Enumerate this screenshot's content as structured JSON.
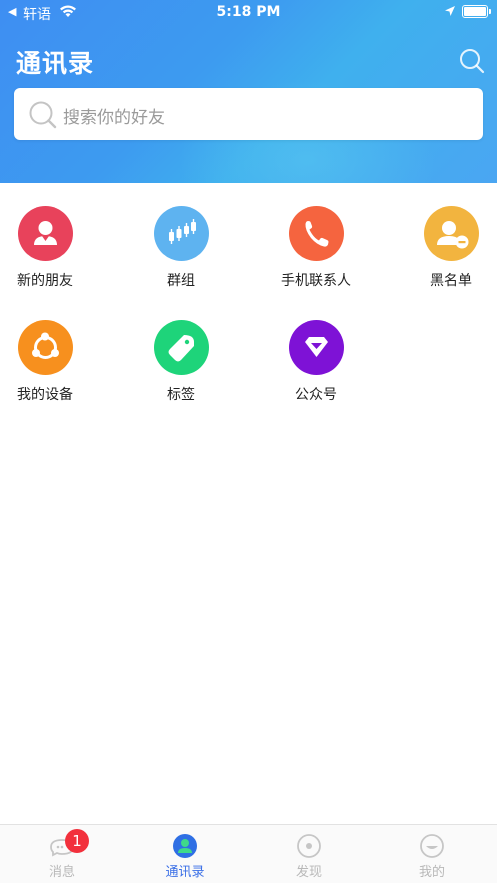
{
  "status_bar": {
    "back_glyph": "◀",
    "carrier": "轩语",
    "time": "5:18 PM"
  },
  "header": {
    "title": "通讯录",
    "search_icon": "search-icon"
  },
  "search": {
    "placeholder": "搜索你的好友"
  },
  "entries": [
    {
      "label": "新的朋友",
      "icon": "new-friend-icon",
      "color": "#e8425b"
    },
    {
      "label": "群组",
      "icon": "group-icon",
      "color": "#5eb3f0"
    },
    {
      "label": "手机联系人",
      "icon": "phone-icon",
      "color": "#f5643f"
    },
    {
      "label": "黑名单",
      "icon": "blacklist-icon",
      "color": "#f2b43f"
    },
    {
      "label": "我的设备",
      "icon": "device-icon",
      "color": "#f7901e"
    },
    {
      "label": "标签",
      "icon": "tag-icon",
      "color": "#1ed47a"
    },
    {
      "label": "公众号",
      "icon": "official-account-icon",
      "color": "#7e12d6"
    }
  ],
  "tabbar": {
    "tabs": [
      {
        "label": "消息",
        "icon": "message-icon",
        "badge": "1",
        "active": false
      },
      {
        "label": "通讯录",
        "icon": "contacts-icon",
        "active": true
      },
      {
        "label": "发现",
        "icon": "discover-icon",
        "active": false
      },
      {
        "label": "我的",
        "icon": "profile-icon",
        "active": false
      }
    ]
  },
  "colors": {
    "accent": "#3a6fe6",
    "badge": "#f2303c"
  }
}
